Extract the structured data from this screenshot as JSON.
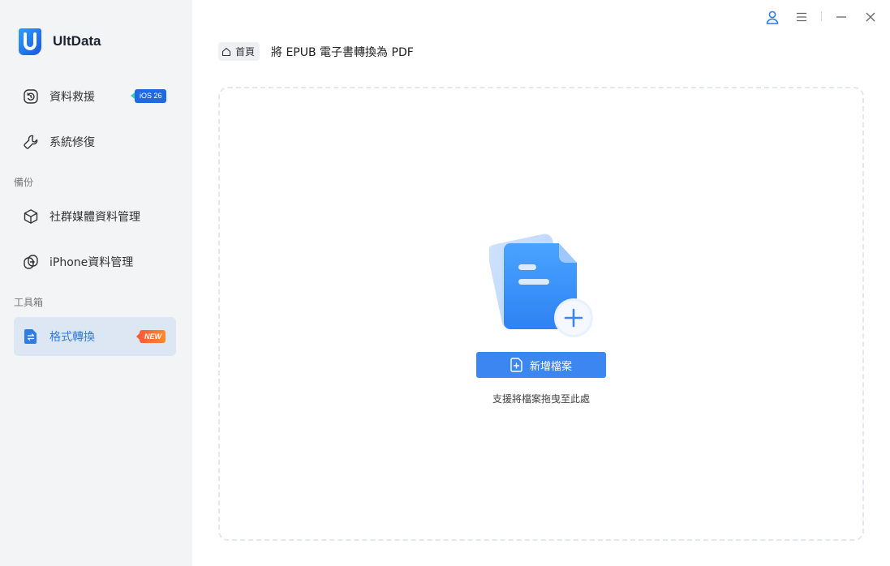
{
  "app": {
    "name": "UltData"
  },
  "sidebar": {
    "items": [
      {
        "label": "資料救援",
        "icon": "restore-icon",
        "badge": "iOS 26"
      },
      {
        "label": "系統修復",
        "icon": "wrench-icon"
      },
      {
        "label": "社群媒體資料管理",
        "icon": "cube-icon"
      },
      {
        "label": "iPhone資料管理",
        "icon": "phone-transfer-icon"
      },
      {
        "label": "格式轉換",
        "icon": "file-convert-icon",
        "badge": "NEW",
        "active": true
      }
    ],
    "sections": {
      "backup": "備份",
      "toolbox": "工具箱"
    }
  },
  "breadcrumb": {
    "home": "首頁",
    "current": "將 EPUB 電子書轉換為 PDF"
  },
  "dropzone": {
    "button_label": "新增檔案",
    "hint": "支援將檔案拖曳至此處"
  },
  "colors": {
    "accent": "#3b86f0",
    "active_bg": "#dde6f3",
    "sidebar_bg": "#f3f4f6"
  }
}
